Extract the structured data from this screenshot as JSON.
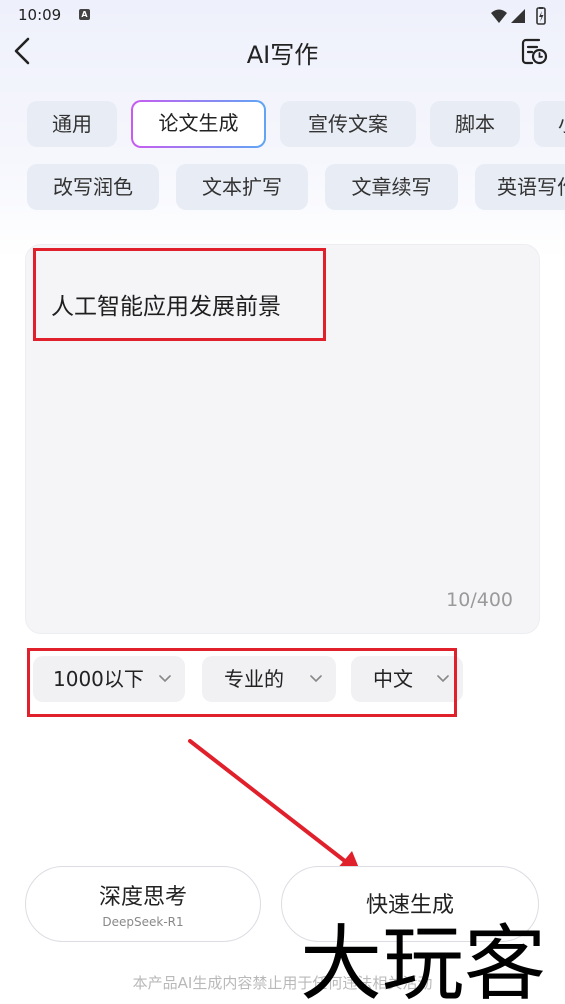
{
  "status_bar": {
    "time": "10:09",
    "notif_glyph": "A",
    "icons": [
      "wifi-icon",
      "signal-icon",
      "battery-icon"
    ]
  },
  "header": {
    "title": "AI写作"
  },
  "tabs_row1": [
    {
      "label": "通用"
    },
    {
      "label": "论文生成",
      "active": true
    },
    {
      "label": "宣传文案"
    },
    {
      "label": "脚本"
    },
    {
      "label": "小"
    }
  ],
  "tabs_row2": [
    {
      "label": "改写润色"
    },
    {
      "label": "文本扩写"
    },
    {
      "label": "文章续写"
    },
    {
      "label": "英语写作"
    }
  ],
  "editor": {
    "value": "人工智能应用发展前景",
    "counter": "10/400"
  },
  "options": {
    "length": "1000以下",
    "tone": "专业的",
    "language": "中文"
  },
  "actions": {
    "deep_think": {
      "label": "深度思考",
      "sublabel": "DeepSeek-R1"
    },
    "quick_generate": {
      "label": "快速生成"
    }
  },
  "footer": {
    "disclaimer": "本产品AI生成内容禁止用于任何违法相关活动"
  },
  "watermark": {
    "text": "大玩客"
  },
  "colors": {
    "highlight": "#e0202b",
    "chip_bg": "#e8ecf5",
    "gradient_start": "#c85cf0",
    "gradient_end": "#5fa6f5"
  }
}
